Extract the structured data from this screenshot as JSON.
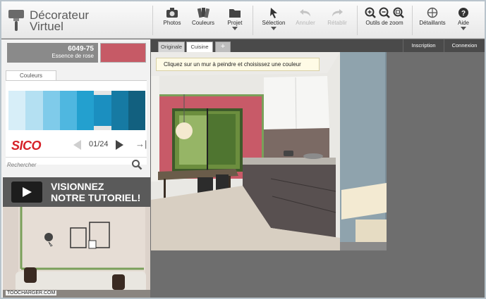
{
  "app": {
    "title_line1": "Décorateur",
    "title_line2": "Virtuel"
  },
  "toolbar": {
    "photos": "Photos",
    "couleurs": "Couleurs",
    "projet": "Projet",
    "selection": "Sélection",
    "annuler": "Annuler",
    "retablir": "Rétablir",
    "zoom": "Outils de zoom",
    "details": "Détaillants",
    "aide": "Aide"
  },
  "color": {
    "code": "6049-75",
    "name": "Essence de rose",
    "swatch": "#c65a66"
  },
  "palette": {
    "tab_label": "Couleurs",
    "swatches": [
      "#d7eef8",
      "#b4e0f2",
      "#7fcbea",
      "#4fb7e0",
      "#23a0cf",
      "#1b8fc0",
      "#167aa3",
      "#12607f"
    ],
    "brand": "SICO",
    "page": "01/24",
    "search_placeholder": "Rechercher"
  },
  "tutorial": {
    "line1": "VISIONNEZ",
    "line2": "NOTRE TUTORIEL!"
  },
  "tabs": {
    "original": "Originale",
    "cuisine": "Cuisine",
    "add": "+"
  },
  "links": {
    "inscription": "Inscription",
    "connexion": "Connexion"
  },
  "hint": "Cliquez sur un mur à peindre et choisissez une couleur",
  "watermark": "TOOCHARGER.COM"
}
